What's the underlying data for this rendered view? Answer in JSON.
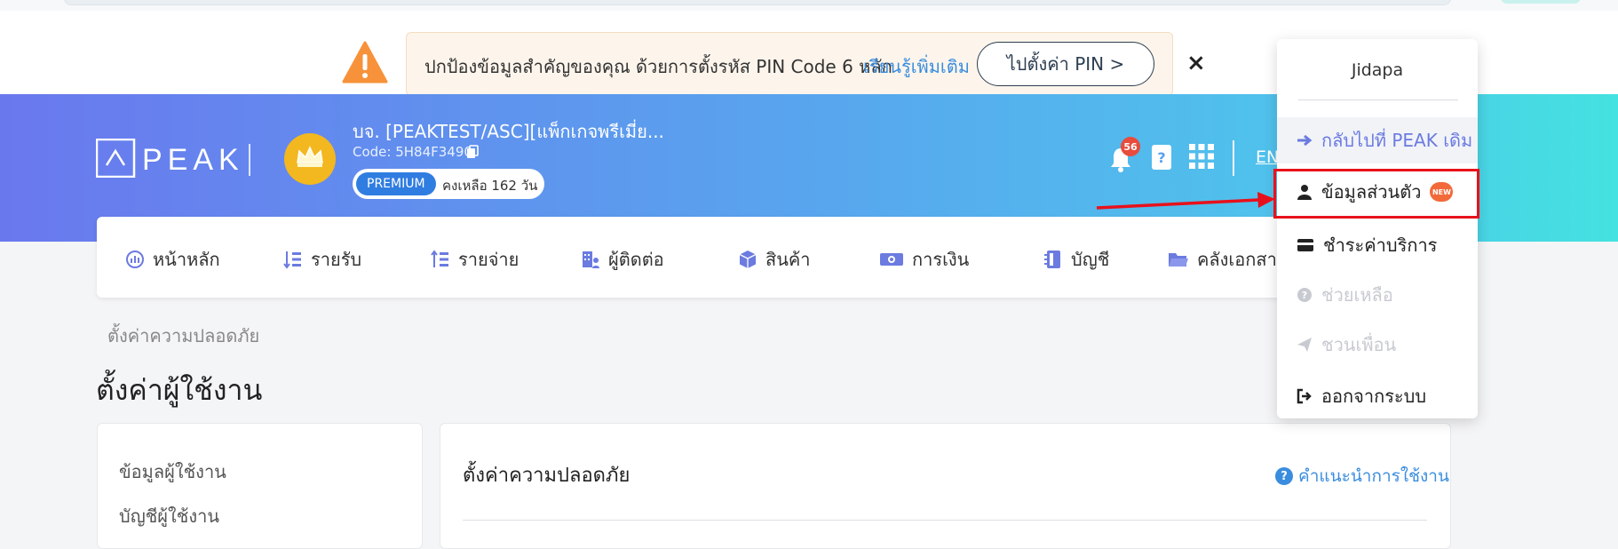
{
  "banner": {
    "message": "ปกป้องข้อมูลสำคัญของคุณ ด้วยการตั้งรหัส PIN Code 6 หลัก",
    "link": "เรียนรู้เพิ่มเติม",
    "button": "ไปตั้งค่า PIN >",
    "close": "×"
  },
  "header": {
    "logo_text": "PEAK",
    "company_name": "บจ. [PEAKTEST/ASC][แพ็กเกจพรีเมี่ย...",
    "company_code": "Code: 5H84F3490",
    "plan_label": "PREMIUM",
    "plan_remaining": "คงเหลือ 162 วัน",
    "notification_count": "56",
    "language": "EN"
  },
  "nav": {
    "items": [
      {
        "label": "หน้าหลัก",
        "icon": "dashboard-icon"
      },
      {
        "label": "รายรับ",
        "icon": "income-icon"
      },
      {
        "label": "รายจ่าย",
        "icon": "expense-icon"
      },
      {
        "label": "ผู้ติดต่อ",
        "icon": "contacts-icon"
      },
      {
        "label": "สินค้า",
        "icon": "product-box-icon"
      },
      {
        "label": "การเงิน",
        "icon": "money-icon"
      },
      {
        "label": "บัญชี",
        "icon": "ledger-icon"
      },
      {
        "label": "คลังเอกสาร",
        "icon": "folder-icon"
      }
    ]
  },
  "page": {
    "breadcrumb": "ตั้งค่าความปลอดภัย",
    "title": "ตั้งค่าผู้ใช้งาน"
  },
  "sidebar": {
    "items": [
      {
        "label": "ข้อมูลผู้ใช้งาน"
      },
      {
        "label": "บัญชีผู้ใช้งาน"
      }
    ]
  },
  "main": {
    "title": "ตั้งค่าความปลอดภัย",
    "help_link": "คำแนะนำการใช้งาน"
  },
  "user_menu": {
    "user_name": "Jidapa",
    "items": [
      {
        "label": "กลับไปที่ PEAK เดิม",
        "icon": "arrow-right-icon"
      },
      {
        "label": "ข้อมูลส่วนตัว",
        "icon": "user-icon",
        "badge": "NEW"
      },
      {
        "label": "ชำระค่าบริการ",
        "icon": "credit-card-icon"
      },
      {
        "label": "ช่วยเหลือ",
        "icon": "question-circle-icon"
      },
      {
        "label": "ชวนเพื่อน",
        "icon": "paper-plane-icon"
      },
      {
        "label": "ออกจากระบบ",
        "icon": "sign-out-icon"
      }
    ]
  },
  "colors": {
    "accent_blue": "#3a8dde",
    "highlight_red": "#e8111b",
    "warning_orange": "#f7923a"
  }
}
